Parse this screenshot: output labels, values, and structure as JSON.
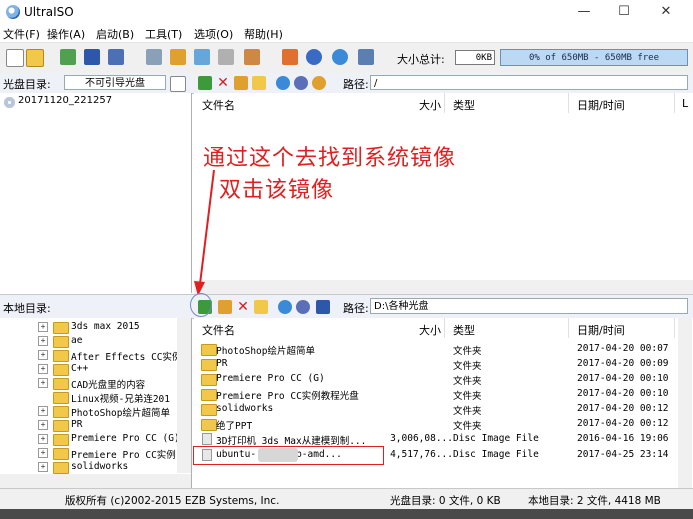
{
  "window": {
    "title": "UltraISO"
  },
  "menu": [
    "文件(F)",
    "操作(A)",
    "启动(B)",
    "工具(T)",
    "选项(O)",
    "帮助(H)"
  ],
  "toolbar": {
    "size_label": "大小总计:",
    "size_value": "0KB",
    "capacity_text": "0% of 650MB - 650MB free"
  },
  "disc_header": {
    "label": "光盘目录:",
    "boot_text": "不可引导光盘",
    "path_label": "路径:",
    "path_value": "/"
  },
  "disc_tree": {
    "root": "20171120_221257"
  },
  "columns": {
    "name": "文件名",
    "size": "大小",
    "type": "类型",
    "date": "日期/时间",
    "extra": "L"
  },
  "annotation": {
    "line1": "通过这个去找到系统镜像",
    "line2": "双击该镜像"
  },
  "local_header": {
    "label": "本地目录:",
    "path_label": "路径:",
    "path_value": "D:\\各种光盘"
  },
  "local_tree": [
    "3ds max 2015",
    "ae",
    "After Effects CC实例",
    "C++",
    "CAD光盘里的内容",
    "Linux视频-兄弟连201",
    "PhotoShop绘片超简单",
    "PR",
    "Premiere Pro CC (G)",
    "Premiere Pro CC实例",
    "solidworks"
  ],
  "local_files": [
    {
      "name": "PhotoShop绘片超简单",
      "size": "",
      "type": "文件夹",
      "date": "2017-04-20 00:07"
    },
    {
      "name": "PR",
      "size": "",
      "type": "文件夹",
      "date": "2017-04-20 00:09"
    },
    {
      "name": "Premiere Pro CC (G)",
      "size": "",
      "type": "文件夹",
      "date": "2017-04-20 00:10"
    },
    {
      "name": "Premiere Pro CC实例教程光盘",
      "size": "",
      "type": "文件夹",
      "date": "2017-04-20 00:10"
    },
    {
      "name": "solidworks",
      "size": "",
      "type": "文件夹",
      "date": "2017-04-20 00:12"
    },
    {
      "name": "绝了PPT",
      "size": "",
      "type": "文件夹",
      "date": "2017-04-20 00:12"
    },
    {
      "name": "3D打印机 3ds Max从建模到制...",
      "size": "3,006,08...",
      "type": "Disc Image File",
      "date": "2016-04-16 19:06"
    },
    {
      "name": "ubuntu-          desktop-amd...",
      "size": "4,517,76...",
      "type": "Disc Image File",
      "date": "2017-04-25 23:14"
    }
  ],
  "status": {
    "copyright": "版权所有 (c)2002-2015 EZB Systems, Inc.",
    "disc": "光盘目录: 0 文件, 0 KB",
    "local": "本地目录: 2 文件, 4418 MB"
  }
}
